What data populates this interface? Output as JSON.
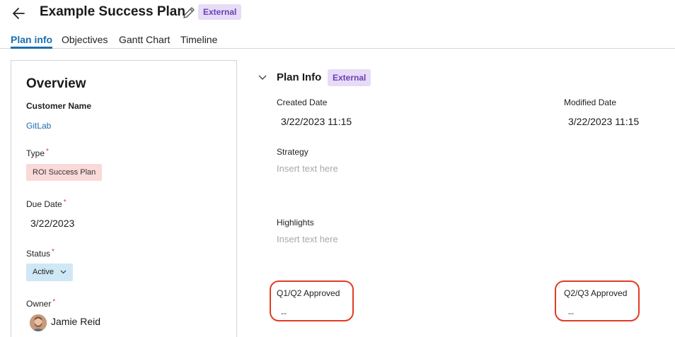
{
  "header": {
    "title": "Example Success Plan",
    "badge": "External"
  },
  "tabs": [
    {
      "label": "Plan info",
      "active": true
    },
    {
      "label": "Objectives",
      "active": false
    },
    {
      "label": "Gantt Chart",
      "active": false
    },
    {
      "label": "Timeline",
      "active": false
    }
  ],
  "overview": {
    "title": "Overview",
    "customer_label": "Customer Name",
    "customer_value": "GitLab",
    "type_label": "Type",
    "type_value": "ROI Success Plan",
    "due_label": "Due Date",
    "due_value": "3/22/2023",
    "status_label": "Status",
    "status_value": "Active",
    "owner_label": "Owner",
    "owner_value": "Jamie Reid",
    "required_mark": "*"
  },
  "plan_info": {
    "title": "Plan Info",
    "badge": "External",
    "created_label": "Created Date",
    "created_value": "3/22/2023 11:15",
    "modified_label": "Modified Date",
    "modified_value": "3/22/2023 11:15",
    "strategy_label": "Strategy",
    "strategy_placeholder": "Insert text here",
    "highlights_label": "Highlights",
    "highlights_placeholder": "Insert text here",
    "q1q2_label": "Q1/Q2 Approved",
    "q1q2_value": "--",
    "q2q3_label": "Q2/Q3 Approved",
    "q2q3_value": "--"
  },
  "colors": {
    "accent": "#1a6fb4",
    "badge_bg": "#e7dcf7",
    "badge_text": "#6b3fb3",
    "required": "#d9373d",
    "type_chip": "#fad9d9",
    "status_chip": "#cfe8f5",
    "highlight": "#e23b26"
  },
  "icons": {
    "back": "arrow-left-icon",
    "edit": "pencil-icon",
    "collapse": "chevron-down-icon",
    "status_dropdown": "chevron-down-icon"
  }
}
